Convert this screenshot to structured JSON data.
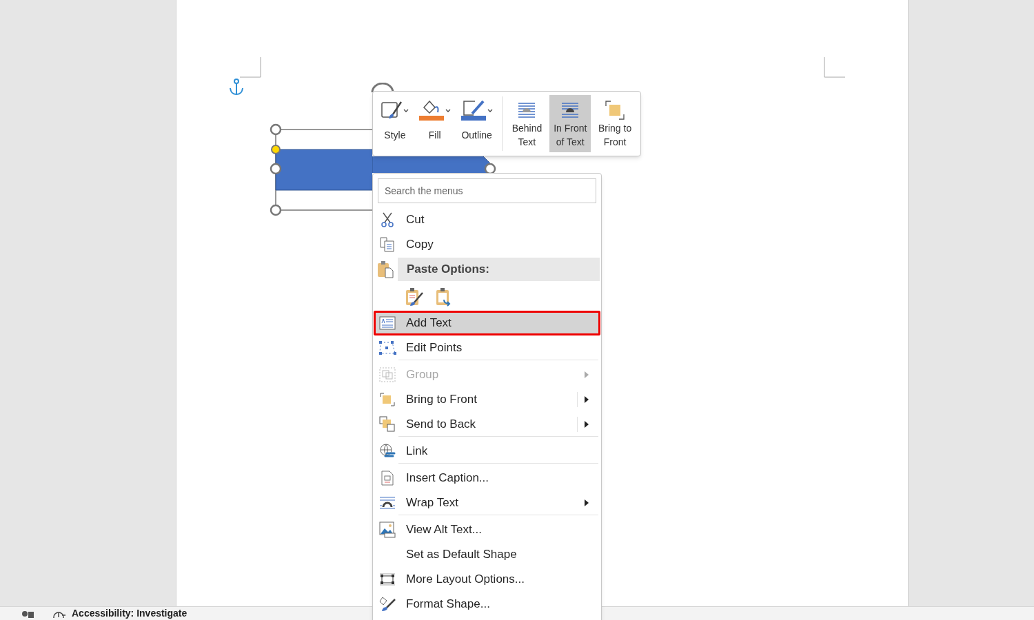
{
  "toolbar": {
    "buttons": [
      {
        "label": "Style",
        "selected": false,
        "dropdown": true
      },
      {
        "label": "Fill",
        "selected": false,
        "dropdown": true,
        "color": "#ed7d31"
      },
      {
        "label": "Outline",
        "selected": false,
        "dropdown": true,
        "color": "#4472c4"
      },
      {
        "label": "Behind Text",
        "selected": false,
        "dropdown": false
      },
      {
        "label": "In Front of Text",
        "selected": true,
        "dropdown": false
      },
      {
        "label": "Bring to Front",
        "selected": false,
        "dropdown": false
      }
    ]
  },
  "context_menu": {
    "search": {
      "placeholder": "Search the menus"
    },
    "items": [
      {
        "kind": "item",
        "label": "Cut",
        "selected": false,
        "disabled": false,
        "submenu": false
      },
      {
        "kind": "item",
        "label": "Copy",
        "selected": false,
        "disabled": false,
        "submenu": false
      },
      {
        "kind": "header",
        "label": "Paste Options:"
      },
      {
        "kind": "paste_icons"
      },
      {
        "kind": "item",
        "label": "Add Text",
        "selected": true,
        "outlined": true,
        "disabled": false,
        "submenu": false
      },
      {
        "kind": "item",
        "label": "Edit Points",
        "selected": false,
        "disabled": false,
        "submenu": false,
        "divider_after": true
      },
      {
        "kind": "item",
        "label": "Group",
        "selected": false,
        "disabled": true,
        "submenu": true
      },
      {
        "kind": "item",
        "label": "Bring to Front",
        "selected": false,
        "disabled": false,
        "submenu": true,
        "split": true
      },
      {
        "kind": "item",
        "label": "Send to Back",
        "selected": false,
        "disabled": false,
        "submenu": true,
        "split": true,
        "divider_after": true
      },
      {
        "kind": "item",
        "label": "Link",
        "selected": false,
        "disabled": false,
        "submenu": false,
        "divider_after": true
      },
      {
        "kind": "item",
        "label": "Insert Caption...",
        "selected": false,
        "disabled": false,
        "submenu": false
      },
      {
        "kind": "item",
        "label": "Wrap Text",
        "selected": false,
        "disabled": false,
        "submenu": true,
        "divider_after": true
      },
      {
        "kind": "item",
        "label": "View Alt Text...",
        "selected": false,
        "disabled": false,
        "submenu": false
      },
      {
        "kind": "item",
        "label": "Set as Default Shape",
        "selected": false,
        "disabled": false,
        "submenu": false
      },
      {
        "kind": "item",
        "label": "More Layout Options...",
        "selected": false,
        "disabled": false,
        "submenu": false
      },
      {
        "kind": "item",
        "label": "Format Shape...",
        "selected": false,
        "disabled": false,
        "submenu": false
      }
    ]
  },
  "status_bar": {
    "accessibility": "Accessibility: Investigate"
  }
}
